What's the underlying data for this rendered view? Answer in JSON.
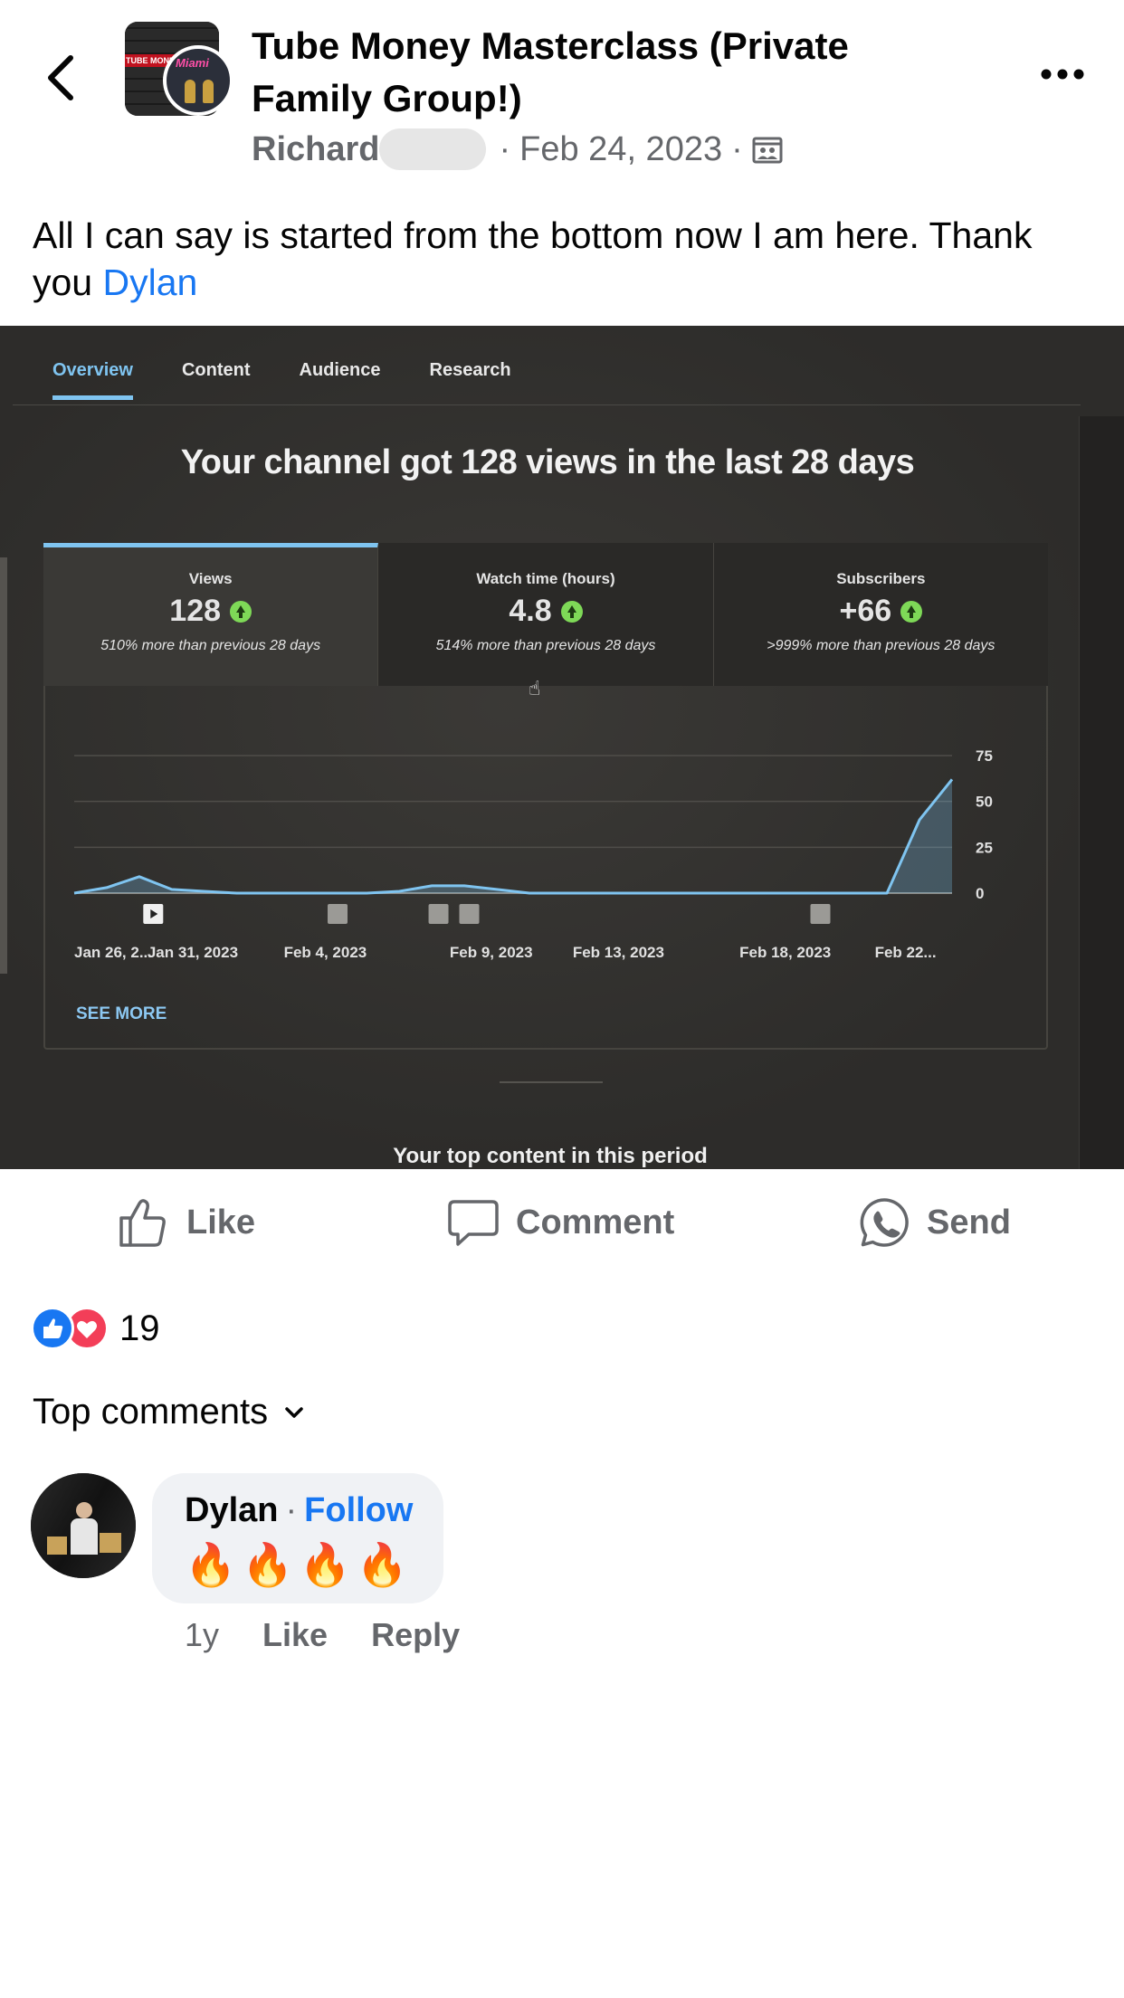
{
  "header": {
    "group_name": "Tube Money Masterclass (Private Family Group!)",
    "author": "Richard",
    "date": "Feb 24, 2023",
    "group_avatar_text": "TUBE MONEY",
    "user_avatar_text": "Miami"
  },
  "post": {
    "text_before_mention": "All I can say is started from the bottom now I am here. Thank you ",
    "mention": "Dylan"
  },
  "photo": {
    "tabs": [
      "Overview",
      "Content",
      "Audience",
      "Research"
    ],
    "headline": "Your channel got 128 views in the last 28 days",
    "metrics": [
      {
        "label": "Views",
        "value": "128",
        "change": "510% more than previous 28 days"
      },
      {
        "label": "Watch time (hours)",
        "value": "4.8",
        "change": "514% more than previous 28 days"
      },
      {
        "label": "Subscribers",
        "value": "+66",
        "change": ">999% more than previous 28 days"
      }
    ],
    "see_more": "SEE MORE",
    "top_content": "Your top content in this period"
  },
  "chart_data": {
    "type": "area",
    "x_tick_labels": [
      "Jan 26, 2...",
      "Jan 31, 2023",
      "Feb 4, 2023",
      "Feb 9, 2023",
      "Feb 13, 2023",
      "Feb 18, 2023",
      "Feb 22..."
    ],
    "y_ticks": [
      0,
      25,
      50,
      75
    ],
    "ylim": [
      0,
      75
    ],
    "x": [
      0,
      1,
      2,
      3,
      4,
      5,
      6,
      7,
      8,
      9,
      10,
      11,
      12,
      13,
      14,
      15,
      16,
      17,
      18,
      19,
      20,
      21,
      22,
      23,
      24,
      25,
      26,
      27
    ],
    "values": [
      0,
      3,
      9,
      2,
      1,
      0,
      0,
      0,
      0,
      0,
      1,
      4,
      4,
      2,
      0,
      0,
      0,
      0,
      0,
      0,
      0,
      0,
      0,
      0,
      0,
      0,
      40,
      62
    ],
    "grid": true,
    "accent": "#7fc4f0"
  },
  "actions": {
    "like": "Like",
    "comment": "Comment",
    "send": "Send"
  },
  "reactions": {
    "count": "19"
  },
  "comments": {
    "sort_label": "Top comments",
    "items": [
      {
        "name": "Dylan",
        "follow": "Follow",
        "text": "🔥🔥🔥🔥",
        "age": "1y",
        "like": "Like",
        "reply": "Reply"
      }
    ]
  },
  "colors": {
    "link": "#1877f2",
    "secondary_text": "#65676b",
    "bubble": "#f0f2f5"
  }
}
